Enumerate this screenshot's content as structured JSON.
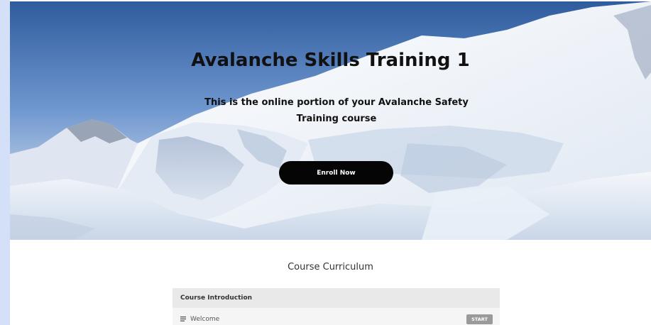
{
  "hero": {
    "title": "Avalanche Skills Training 1",
    "subtitle": "This is the online portion of your Avalanche Safety Training course",
    "enroll_label": "Enroll Now"
  },
  "curriculum": {
    "heading": "Course Curriculum",
    "sections": [
      {
        "title": "Course Introduction",
        "lectures": [
          {
            "title": "Welcome",
            "icon": "text-lines-icon",
            "action_label": "START"
          }
        ]
      }
    ]
  },
  "colors": {
    "page_bg_strip": "#d4dff8",
    "button_dark": "#050505",
    "start_badge": "#9a9a9a",
    "section_header_bg": "#e9e9e9"
  }
}
